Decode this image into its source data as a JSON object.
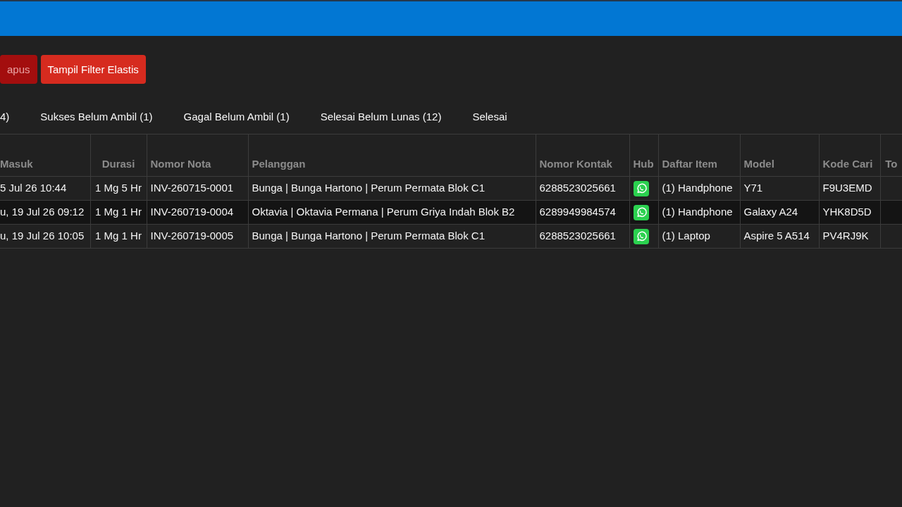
{
  "toolbar": {
    "buttons": [
      {
        "label": "apus",
        "disabled": true
      },
      {
        "label": "Tampil Filter Elastis",
        "disabled": false
      }
    ]
  },
  "tabs": [
    {
      "label": "4)",
      "selected": false
    },
    {
      "label": "Sukses Belum Ambil (1)",
      "selected": false
    },
    {
      "label": "Gagal Belum Ambil (1)",
      "selected": false
    },
    {
      "label": "Selesai Belum Lunas (12)",
      "selected": false
    },
    {
      "label": "Selesai",
      "selected": false
    }
  ],
  "table": {
    "columns": [
      {
        "label": "Masuk",
        "kind": "text"
      },
      {
        "label": "Durasi",
        "kind": "text"
      },
      {
        "label": "Nomor Nota",
        "kind": "text"
      },
      {
        "label": "Pelanggan",
        "kind": "text"
      },
      {
        "label": "Nomor Kontak",
        "kind": "text"
      },
      {
        "label": "Hub",
        "kind": "icon"
      },
      {
        "label": "Daftar Item",
        "kind": "text"
      },
      {
        "label": "Model",
        "kind": "text"
      },
      {
        "label": "Kode Cari",
        "kind": "text"
      },
      {
        "label": "To",
        "kind": "text"
      }
    ],
    "rows": [
      {
        "cells": [
          "5 Jul 26 10:44",
          "1 Mg 5 Hr",
          "INV-260715-0001",
          "Bunga | Bunga Hartono | Perum Permata Blok C1",
          "6288523025661",
          "",
          "(1) Handphone",
          "Y71",
          "F9U3EMD"
        ]
      },
      {
        "cells": [
          "u, 19 Jul 26 09:12",
          "1 Mg 1 Hr",
          "INV-260719-0004",
          "Oktavia | Oktavia Permana | Perum Griya Indah Blok B2",
          "6289949984574",
          "",
          "(1) Handphone",
          "Galaxy A24",
          "YHK8D5D"
        ]
      },
      {
        "cells": [
          "u, 19 Jul 26 10:05",
          "1 Mg 1 Hr",
          "INV-260719-0005",
          "Bunga | Bunga Hartono | Perum Permata Blok C1",
          "6288523025661",
          "",
          "(1) Laptop",
          "Aspire 5 A514",
          "PV4RJ9K"
        ]
      }
    ]
  }
}
